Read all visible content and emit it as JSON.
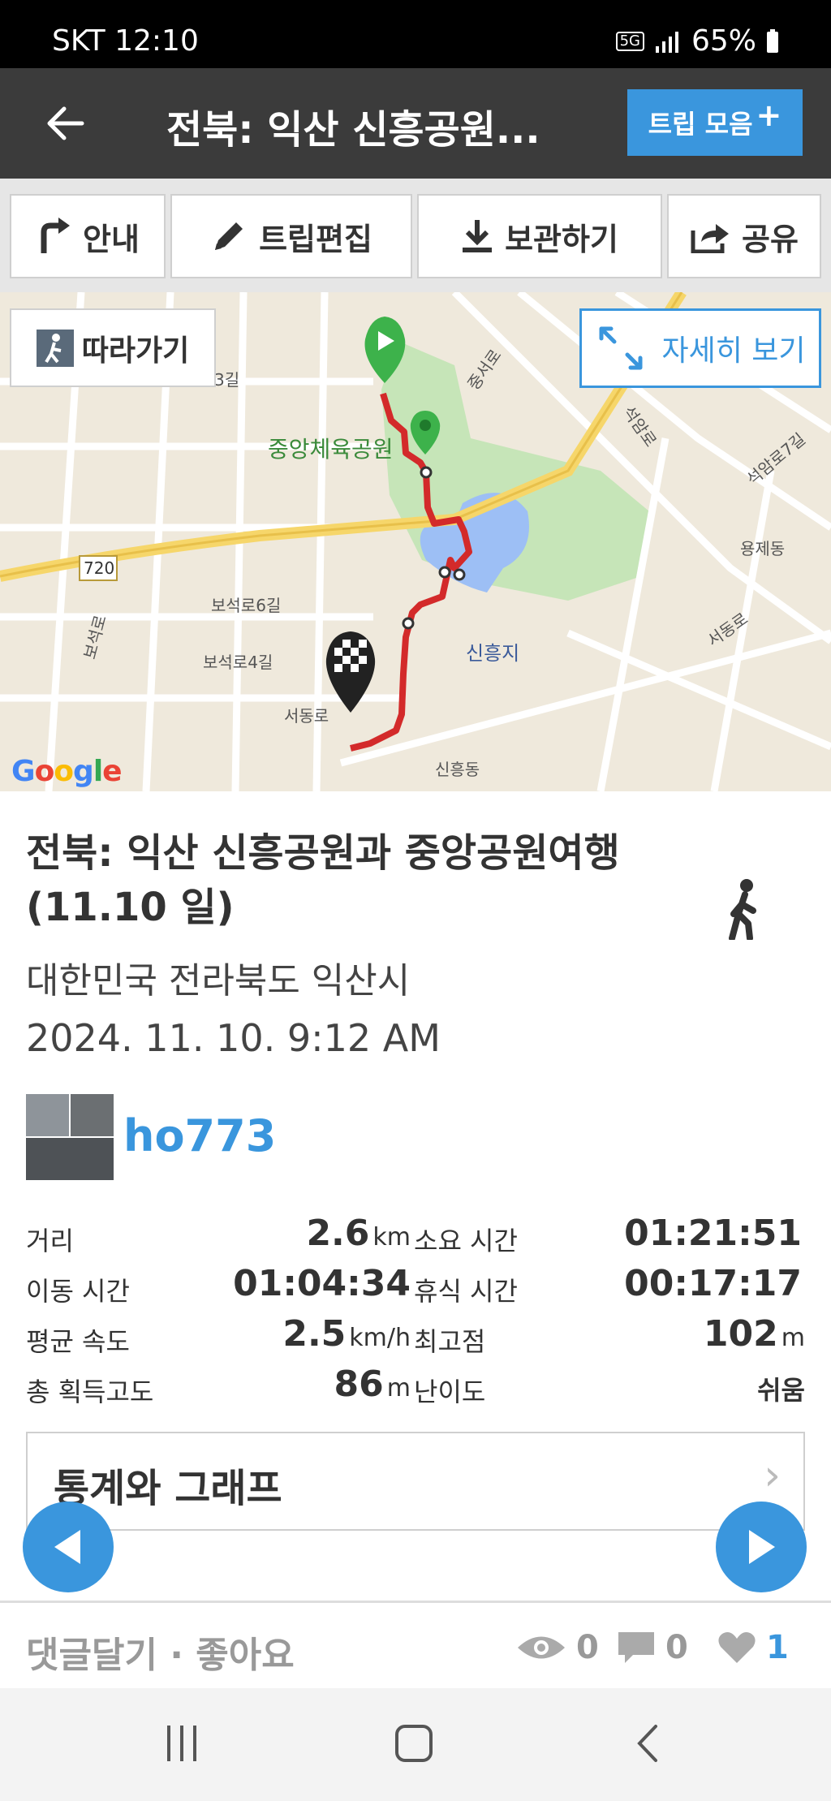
{
  "status_bar": {
    "carrier_time": "SKT 12:10",
    "network": "5G",
    "battery": "65%"
  },
  "header": {
    "title": "전북: 익산 신흥공원...",
    "trip_collection_label": "트립 모음"
  },
  "toolbar": {
    "guide": "안내",
    "edit_trip": "트립편집",
    "save": "보관하기",
    "share": "공유"
  },
  "map": {
    "follow_label": "따라가기",
    "detail_label": "자세히 보기",
    "labels": {
      "park": "중앙체육공원",
      "lake": "신흥지",
      "road_720": "720",
      "boseok6": "보석로6길",
      "boseok4": "보석로4길",
      "seodong": "서동로",
      "singheung_dong": "신흥동",
      "yongje_dong": "용제동",
      "seodongro_right": "서동로",
      "seogamro": "석암로",
      "bogmeokro": "보석로",
      "jongseoro": "중서로",
      "sam_gil": "3길",
      "seogam_right": "석암로7길"
    },
    "google": "Google"
  },
  "trip": {
    "title": "전북: 익산 신흥공원과 중앙공원여행(11.10 일)",
    "location": "대한민국 전라북도 익산시",
    "datetime": "2024. 11. 10. 9:12 AM",
    "user": "ho773"
  },
  "stats": {
    "distance": {
      "label": "거리",
      "value": "2.6",
      "unit": "km"
    },
    "duration": {
      "label": "소요 시간",
      "value": "01:21:51"
    },
    "moving_time": {
      "label": "이동 시간",
      "value": "01:04:34"
    },
    "rest_time": {
      "label": "휴식 시간",
      "value": "00:17:17"
    },
    "avg_speed": {
      "label": "평균 속도",
      "value": "2.5",
      "unit": "km/h"
    },
    "max_altitude": {
      "label": "최고점",
      "value": "102",
      "unit": "m"
    },
    "elevation_gain": {
      "label": "총 획득고도",
      "value": "86",
      "unit": "m"
    },
    "difficulty": {
      "label": "난이도",
      "value": "쉬움"
    }
  },
  "stats_graph_label": "통계와 그래프",
  "actions": {
    "comment_like": "댓글달기 · 좋아요",
    "views": "0",
    "comments": "0",
    "likes": "1"
  },
  "colors": {
    "accent": "#3a96dd",
    "header_bg": "#3b3b3b",
    "route": "#d32a2a",
    "start_pin": "#3db24b"
  }
}
